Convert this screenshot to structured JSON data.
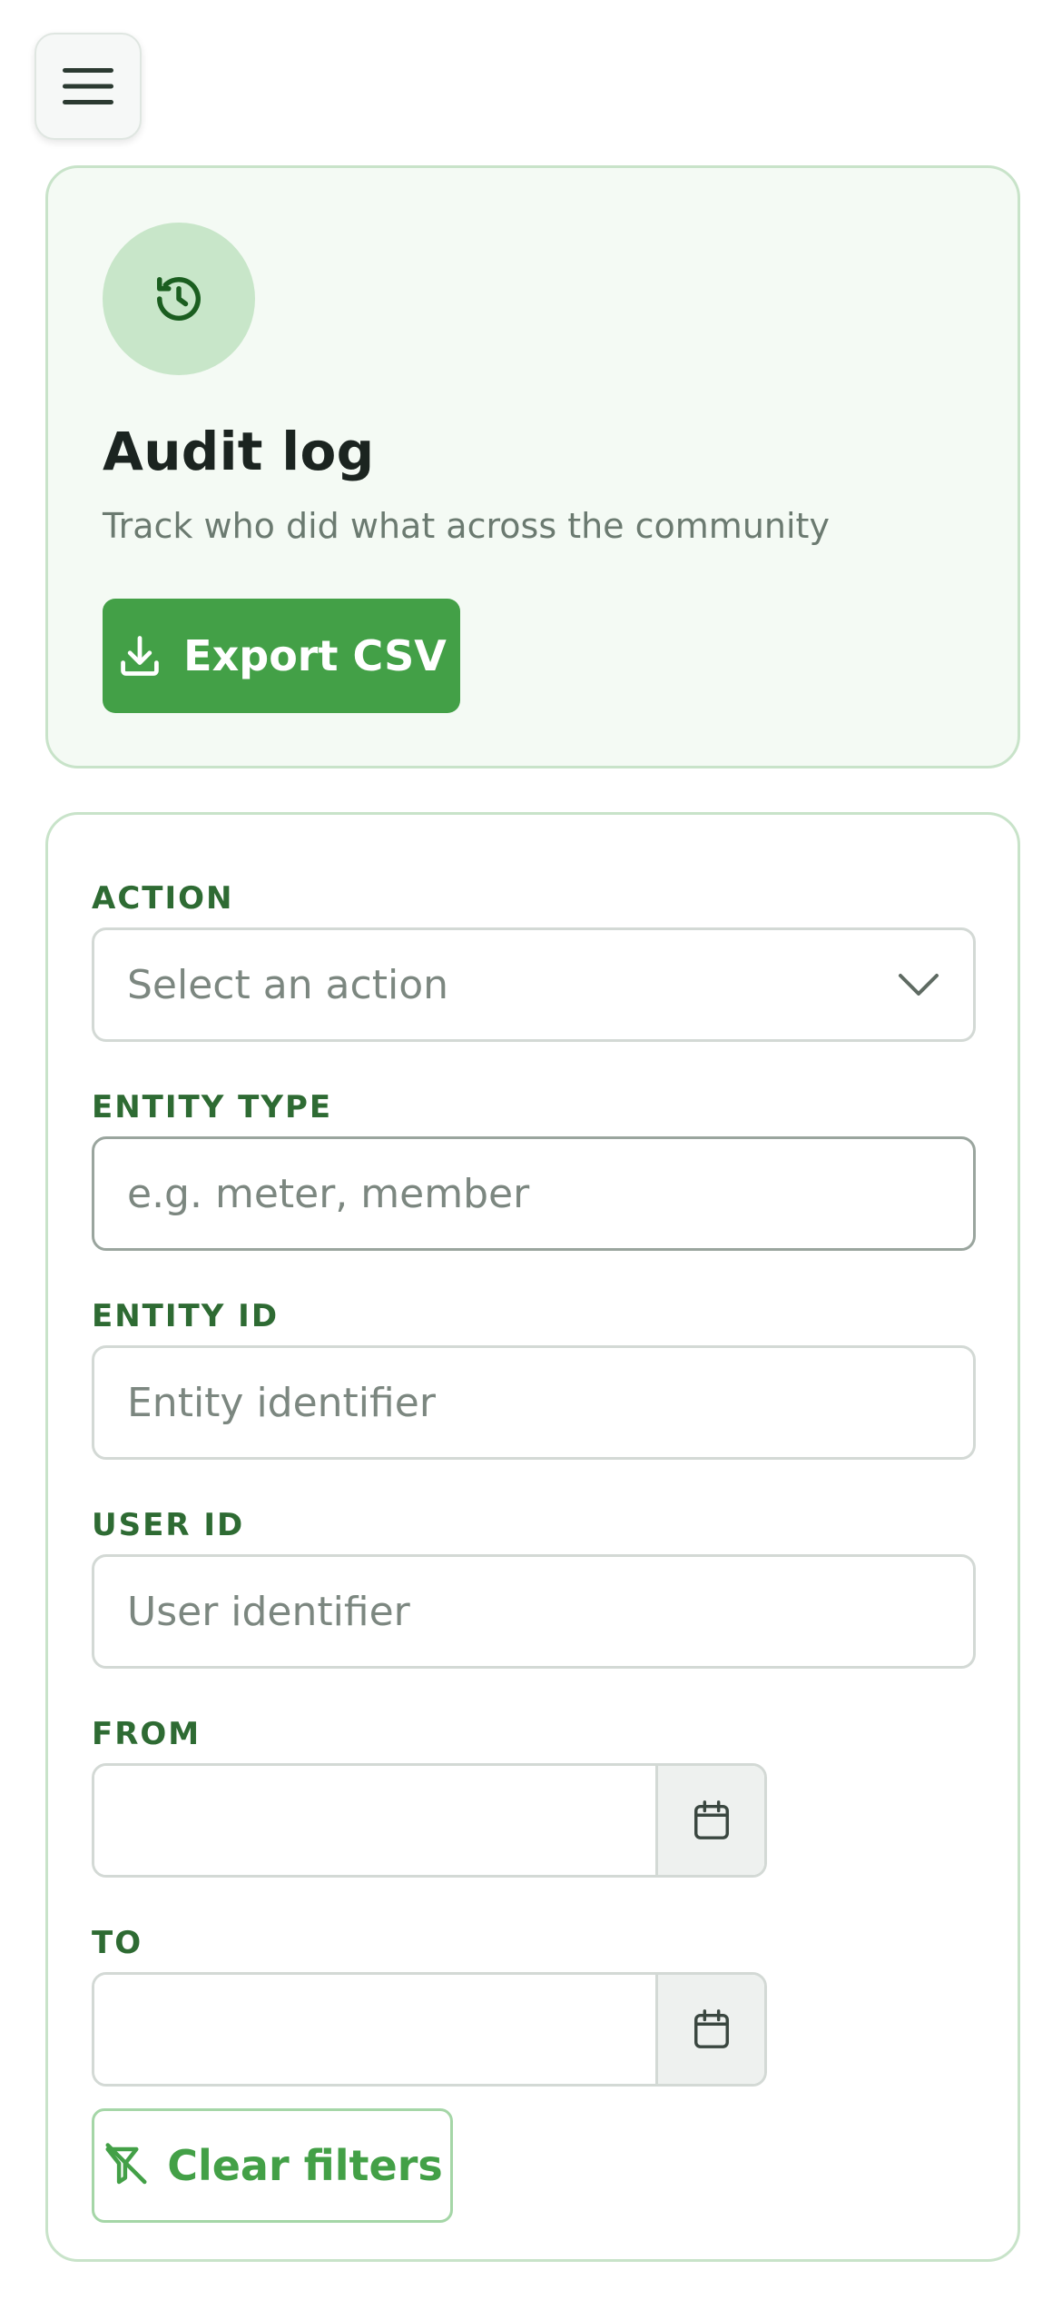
{
  "nav": {
    "menu_icon": "hamburger-menu-icon"
  },
  "header": {
    "icon": "history-icon",
    "title": "Audit log",
    "subtitle": "Track who did what across the community",
    "export_label": "Export CSV",
    "export_icon": "download-icon"
  },
  "filters": {
    "action": {
      "label": "ACTION",
      "placeholder": "Select an action",
      "icon": "chevron-down-icon"
    },
    "entity_type": {
      "label": "ENTITY TYPE",
      "placeholder": "e.g. meter, member"
    },
    "entity_id": {
      "label": "ENTITY ID",
      "placeholder": "Entity identifier"
    },
    "user_id": {
      "label": "USER ID",
      "placeholder": "User identifier"
    },
    "from": {
      "label": "FROM",
      "icon": "calendar-icon"
    },
    "to": {
      "label": "TO",
      "icon": "calendar-icon"
    },
    "clear_label": "Clear filters",
    "clear_icon": "filter-clear-icon"
  },
  "colors": {
    "primary": "#43a047",
    "label": "#2e6b33",
    "card_border": "#c8e3c9",
    "hero_background": "#f4faf4",
    "icon_circle": "#c8e6c9"
  }
}
